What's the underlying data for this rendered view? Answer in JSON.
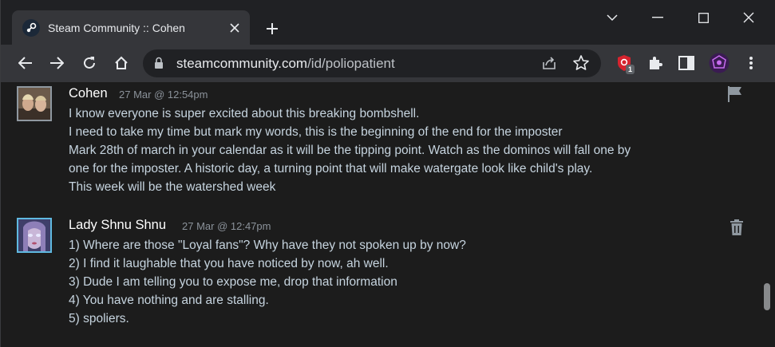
{
  "browser": {
    "tab_title": "Steam Community :: Cohen",
    "url_host": "steamcommunity.com",
    "url_path": "/id/poliopatient",
    "extension_badge": "1"
  },
  "comments": [
    {
      "author": "Cohen",
      "timestamp": "27 Mar @ 12:54pm",
      "action": "flag-icon",
      "lines": [
        "I know everyone is super excited about this breaking bombshell.",
        "I need to take my time but mark my words, this is the beginning of the end for the imposter",
        "Mark 28th of march in your calendar as it will be the tipping point. Watch as the dominos will fall one by",
        "one for the imposter. A historic day, a turning point that will make watergate look like child's play.",
        "This week will be the watershed week"
      ]
    },
    {
      "author": "Lady Shnu Shnu",
      "timestamp": "27 Mar @ 12:47pm",
      "action": "trash-icon",
      "lines": [
        "1) Where are those \"Loyal fans\"? Why have they not spoken up by now?",
        "2) I find it laughable that you have noticed by now, ah well.",
        "3) Dude I am telling you to expose me, drop that information",
        "4) You have nothing and are stalling.",
        "5) spoliers."
      ]
    }
  ],
  "colors": {
    "page_bg": "#1c1c1c",
    "comment_text": "#c6d4df",
    "timestamp": "#8b929a",
    "toolbar": "#35363a",
    "tabstrip": "#202124"
  }
}
